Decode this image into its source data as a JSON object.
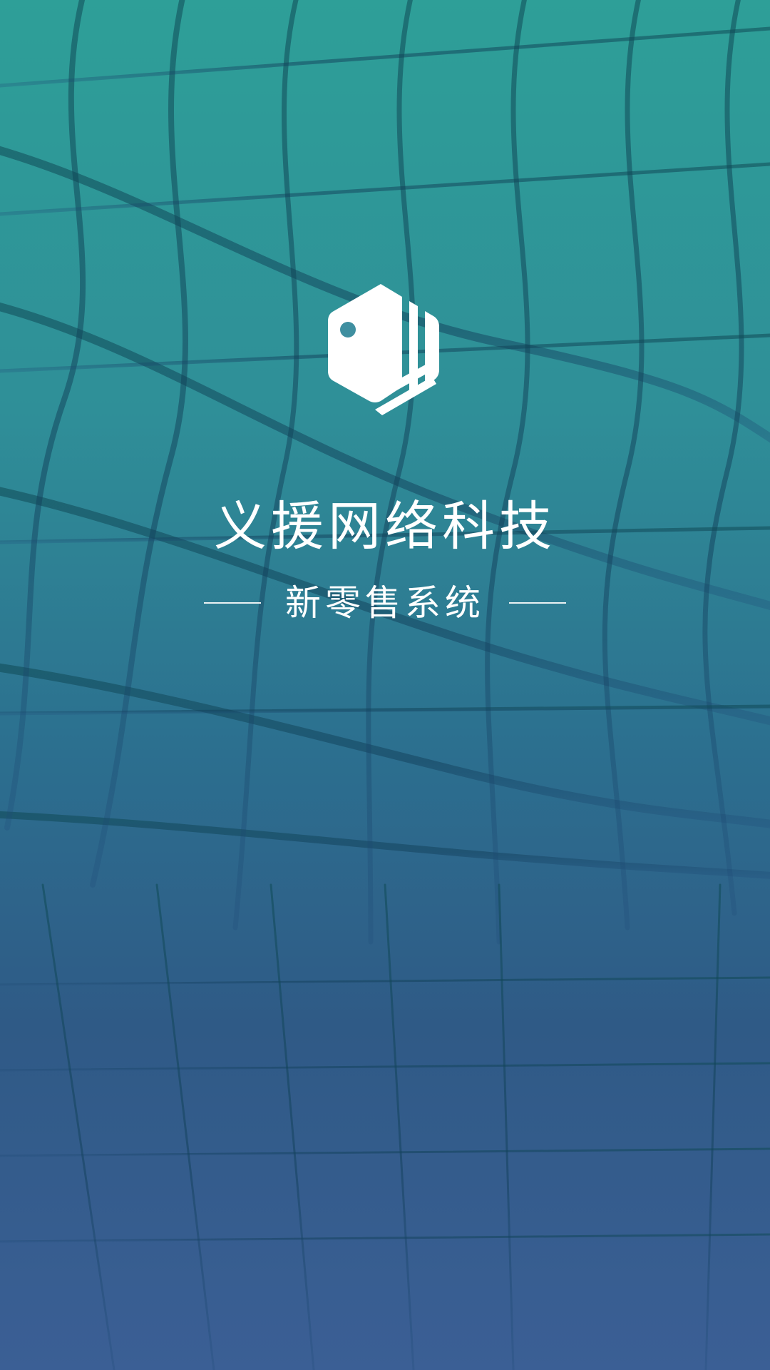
{
  "app": {
    "title": "义援网络科技",
    "subtitle": "新零售系统",
    "logo_icon": "cube-logo-icon"
  },
  "colors": {
    "gradient_top": "#2e9f98",
    "gradient_bottom": "#3b5f95",
    "text": "#ffffff",
    "mesh": "#1c5a66"
  }
}
